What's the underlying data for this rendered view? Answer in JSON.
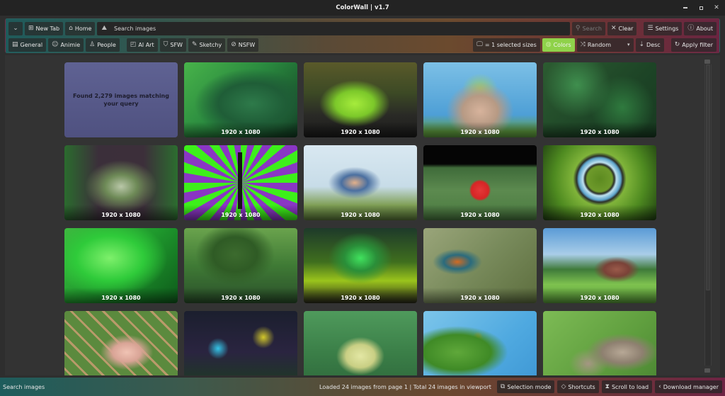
{
  "window": {
    "title": "ColorWall | v1.7",
    "controls": [
      "minimize",
      "maximize",
      "close"
    ]
  },
  "toolbar": {
    "row1": {
      "dropdown_icon": "chevron-down-icon",
      "new_tab_label": "New Tab",
      "home_label": "Home",
      "search_placeholder": "Search images",
      "search_value": "",
      "search_button_label": "Search",
      "clear_label": "Clear",
      "settings_label": "Settings",
      "about_label": "About"
    },
    "row2": {
      "categories": [
        {
          "label": "General",
          "icon": "window-icon"
        },
        {
          "label": "Animie",
          "icon": "cat-face-icon"
        },
        {
          "label": "People",
          "icon": "person-icon"
        }
      ],
      "purity": [
        {
          "label": "AI Art",
          "icon": "sparkle-frame-icon"
        },
        {
          "label": "SFW",
          "icon": "shield-check-icon"
        },
        {
          "label": "Sketchy",
          "icon": "sketch-icon"
        },
        {
          "label": "NSFW",
          "icon": "block-icon"
        }
      ],
      "sizes_label": "= 1 selected sizes",
      "colors_label": "Colors",
      "colors_active_color": "#8fd24a",
      "sort_label": "Random",
      "order_label": "Desc",
      "apply_label": "Apply filter"
    }
  },
  "results": {
    "summary": "Found 2,279 images matching your query",
    "tiles": [
      {
        "resolution": "1920 x 1080",
        "subject": "green warrior silhouette"
      },
      {
        "resolution": "1920 x 1080",
        "subject": "lime green sports car"
      },
      {
        "resolution": "1920 x 1080",
        "subject": "anime character with giant body"
      },
      {
        "resolution": "1920 x 1080",
        "subject": "green leaves"
      },
      {
        "resolution": "1920 x 1080",
        "subject": "demon on throne"
      },
      {
        "resolution": "1920 x 1080",
        "subject": "purple green sunburst figure"
      },
      {
        "resolution": "1920 x 1080",
        "subject": "woman sitting near windmill"
      },
      {
        "resolution": "1920 x 1080",
        "subject": "pokeball on grass"
      },
      {
        "resolution": "1920 x 1080",
        "subject": "tiny planet ring"
      },
      {
        "resolution": "1920 x 1080",
        "subject": "green forest creature"
      },
      {
        "resolution": "1920 x 1080",
        "subject": "giant forest tree"
      },
      {
        "resolution": "1920 x 1080",
        "subject": "green fel demon"
      },
      {
        "resolution": "1920 x 1080",
        "subject": "kingfisher on twig"
      },
      {
        "resolution": "1920 x 1080",
        "subject": "anime barn landscape"
      },
      {
        "resolution": "",
        "subject": "woman at bamboo fence"
      },
      {
        "resolution": "",
        "subject": "robots in dark forest"
      },
      {
        "resolution": "",
        "subject": "tickets plz crewmate"
      },
      {
        "resolution": "",
        "subject": "topiary mouse with butterfly"
      },
      {
        "resolution": "",
        "subject": "wolf pups"
      }
    ]
  },
  "scrollbar": {
    "position_fraction": 0.0,
    "visible_fraction": 0.75
  },
  "statusbar": {
    "left_text": "Search images",
    "info": "Loaded 24 images from page 1 | Total 24 images in viewport",
    "selection_mode_label": "Selection mode",
    "shortcuts_label": "Shortcuts",
    "scroll_to_load_label": "Scroll to load",
    "download_manager_label": "Download manager"
  }
}
